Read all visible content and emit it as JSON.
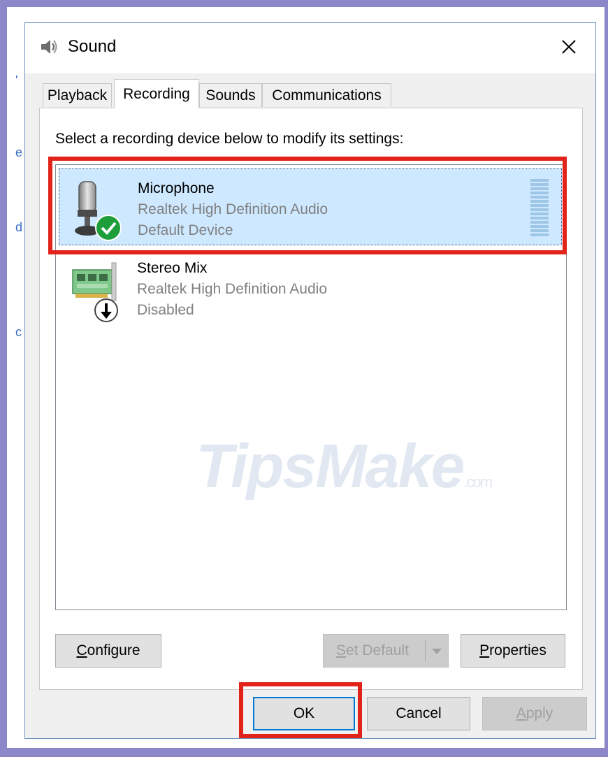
{
  "window": {
    "title": "Sound"
  },
  "tabs": [
    {
      "label": "Playback",
      "active": false
    },
    {
      "label": "Recording",
      "active": true
    },
    {
      "label": "Sounds",
      "active": false
    },
    {
      "label": "Communications",
      "active": false
    }
  ],
  "instruction": "Select a recording device below to modify its settings:",
  "devices": [
    {
      "name": "Microphone",
      "driver": "Realtek High Definition Audio",
      "status": "Default Device",
      "icon": "microphone-icon",
      "badge": "checkmark-badge",
      "selected": true
    },
    {
      "name": "Stereo Mix",
      "driver": "Realtek High Definition Audio",
      "status": "Disabled",
      "icon": "sound-card-icon",
      "badge": "down-arrow-badge",
      "selected": false
    }
  ],
  "watermark": {
    "main": "TipsMake",
    "suffix": ".com"
  },
  "buttons": {
    "configure": {
      "prefix": "",
      "accel": "C",
      "rest": "onfigure"
    },
    "set_default": {
      "prefix": "",
      "accel": "S",
      "rest": "et Default",
      "disabled": true
    },
    "properties": {
      "prefix": "",
      "accel": "P",
      "rest": "roperties"
    },
    "ok": "OK",
    "cancel": "Cancel",
    "apply": {
      "prefix": "",
      "accel": "A",
      "rest": "pply",
      "disabled": true
    }
  },
  "colors": {
    "selection": "#cde8ff",
    "highlight_box": "#e2231a",
    "default_badge": "#1e9e3a",
    "background_frame": "#8b87c9"
  }
}
